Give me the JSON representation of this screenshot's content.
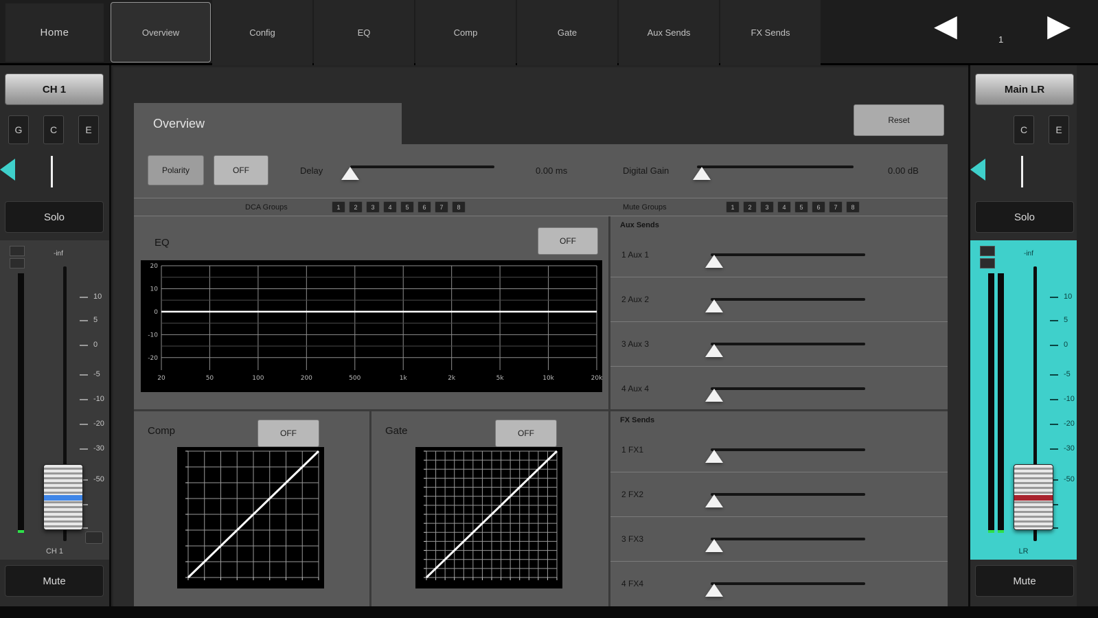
{
  "topbar": {
    "home_label": "Home",
    "tabs": [
      {
        "label": "Overview",
        "selected": true
      },
      {
        "label": "Config",
        "selected": false
      },
      {
        "label": "EQ",
        "selected": false
      },
      {
        "label": "Comp",
        "selected": false
      },
      {
        "label": "Gate",
        "selected": false
      },
      {
        "label": "Aux Sends",
        "selected": false
      },
      {
        "label": "FX Sends",
        "selected": false
      }
    ],
    "page_indicator": "1",
    "prev_icon": "◀",
    "next_icon": "▶"
  },
  "left_strip": {
    "channel_label": "CH 1",
    "small_buttons": [
      "G",
      "C",
      "E"
    ],
    "solo_label": "Solo",
    "mute_label": "Mute",
    "meter_top_label": "-inf",
    "meter_scale": [
      "10",
      "5",
      "0",
      "-5",
      "-10",
      "-20",
      "-30",
      "-50"
    ],
    "fader_name": "CH 1"
  },
  "right_strip": {
    "channel_label": "Main LR",
    "small_buttons": [
      "C",
      "E"
    ],
    "solo_label": "Solo",
    "mute_label": "Mute",
    "meter_top_label": "-inf",
    "meter_scale": [
      "10",
      "5",
      "0",
      "-5",
      "-10",
      "-20",
      "-30",
      "-50"
    ],
    "fader_name": "LR"
  },
  "overview": {
    "tab_title": "Overview",
    "reset_label": "Reset",
    "polarity_label": "Polarity",
    "polarity_state": "OFF",
    "delay_label": "Delay",
    "delay_value": "0.00 ms",
    "delay_position_pct": 0,
    "digital_gain_label": "Digital Gain",
    "digital_gain_value": "0.00 dB",
    "digital_gain_position_pct": 3,
    "dca_groups_label": "DCA Groups",
    "dca_groups": [
      "1",
      "2",
      "3",
      "4",
      "5",
      "6",
      "7",
      "8"
    ],
    "mute_groups_label": "Mute Groups",
    "mute_groups": [
      "1",
      "2",
      "3",
      "4",
      "5",
      "6",
      "7",
      "8"
    ],
    "eq": {
      "label": "EQ",
      "state": "OFF",
      "graph": {
        "type": "line",
        "y_labels": [
          "20",
          "10",
          "0",
          "-10",
          "-20"
        ],
        "x_labels": [
          "20",
          "50",
          "100",
          "200",
          "500",
          "1k",
          "2k",
          "5k",
          "10k",
          "20k"
        ],
        "curve": "flat",
        "curve_db": 0
      }
    },
    "comp": {
      "label": "Comp",
      "state": "OFF",
      "graph": {
        "type": "line",
        "shape": "diagonal"
      }
    },
    "gate": {
      "label": "Gate",
      "state": "OFF",
      "graph": {
        "type": "line",
        "shape": "diagonal"
      }
    },
    "aux_sends": {
      "header": "Aux Sends",
      "sends": [
        {
          "label": "1 Aux 1",
          "position_pct": 2
        },
        {
          "label": "2 Aux 2",
          "position_pct": 2
        },
        {
          "label": "3 Aux 3",
          "position_pct": 2
        },
        {
          "label": "4 Aux 4",
          "position_pct": 2
        }
      ]
    },
    "fx_sends": {
      "header": "FX Sends",
      "sends": [
        {
          "label": "1 FX1",
          "position_pct": 2
        },
        {
          "label": "2 FX2",
          "position_pct": 2
        },
        {
          "label": "3 FX3",
          "position_pct": 2
        },
        {
          "label": "4 FX4",
          "position_pct": 2
        }
      ]
    }
  },
  "colors": {
    "accent": "#3fd0cb",
    "panel": "#595959",
    "graph_bg": "#000000"
  }
}
